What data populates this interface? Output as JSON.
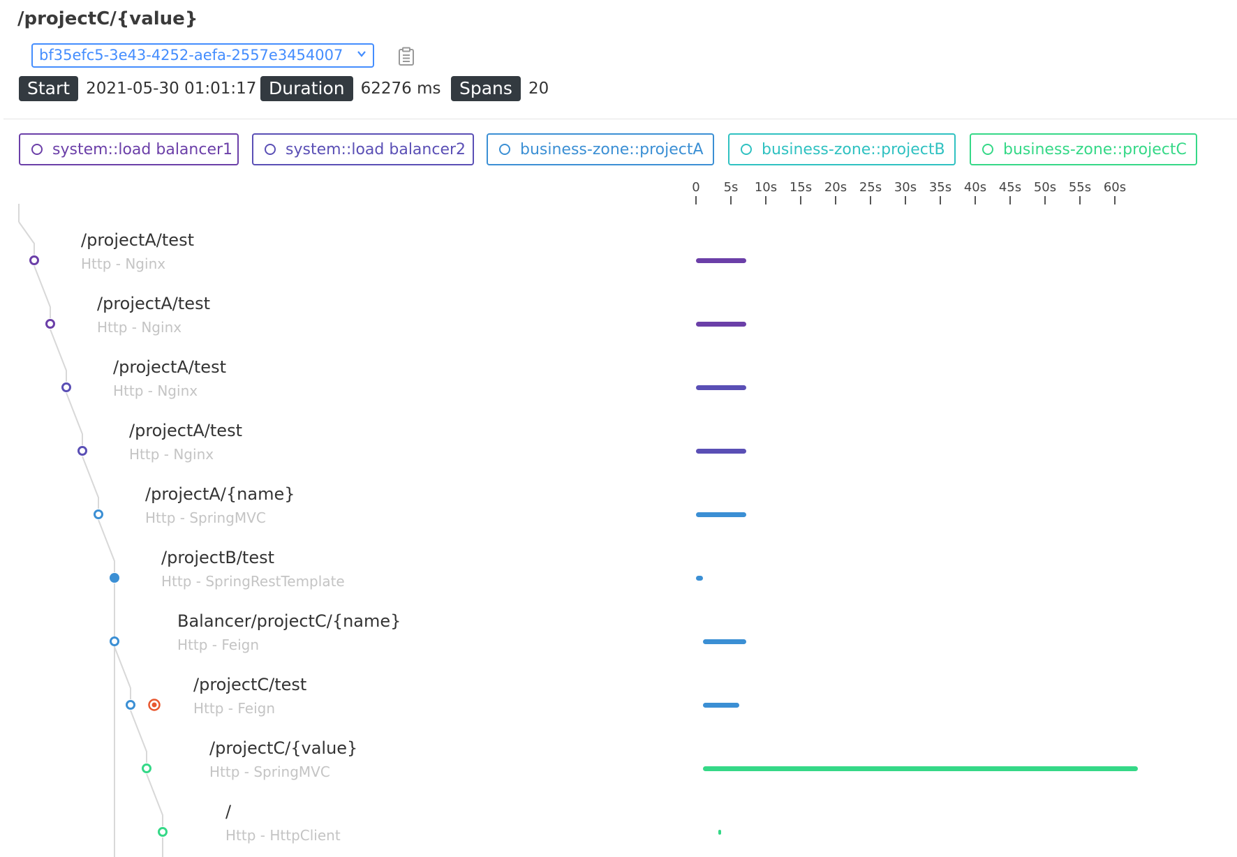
{
  "header": {
    "title": "/projectC/{value}",
    "trace_id": "bf35efc5-3e43-4252-aefa-2557e3454007",
    "copy_icon": "clipboard-icon"
  },
  "meta": {
    "start_label": "Start",
    "start_value": "2021-05-30 01:01:17",
    "duration_label": "Duration",
    "duration_value": "62276 ms",
    "spans_label": "Spans",
    "spans_value": "20"
  },
  "legend": [
    {
      "label": "system::load balancer1",
      "color": "#6b3fa8"
    },
    {
      "label": "system::load balancer2",
      "color": "#5a4fb5"
    },
    {
      "label": "business-zone::projectA",
      "color": "#3b8fd4"
    },
    {
      "label": "business-zone::projectB",
      "color": "#2fc1c1"
    },
    {
      "label": "business-zone::projectC",
      "color": "#35d887"
    }
  ],
  "axis": {
    "unit": "s",
    "ticks": [
      "0",
      "5s",
      "10s",
      "15s",
      "20s",
      "25s",
      "30s",
      "35s",
      "40s",
      "45s",
      "50s",
      "55s",
      "60s"
    ],
    "tick_values": [
      0,
      5,
      10,
      15,
      20,
      25,
      30,
      35,
      40,
      45,
      50,
      55,
      60
    ]
  },
  "spans": [
    {
      "name": "/projectA/test",
      "sub": "Http - Nginx",
      "color": "#6b3fa8",
      "start_s": 0.0,
      "end_s": 7.2,
      "depth": 0,
      "node": "ring"
    },
    {
      "name": "/projectA/test",
      "sub": "Http - Nginx",
      "color": "#6b3fa8",
      "start_s": 0.0,
      "end_s": 7.2,
      "depth": 1,
      "node": "ring"
    },
    {
      "name": "/projectA/test",
      "sub": "Http - Nginx",
      "color": "#5a4fb5",
      "start_s": 0.0,
      "end_s": 7.2,
      "depth": 2,
      "node": "ring"
    },
    {
      "name": "/projectA/test",
      "sub": "Http - Nginx",
      "color": "#5a4fb5",
      "start_s": 0.0,
      "end_s": 7.2,
      "depth": 3,
      "node": "ring"
    },
    {
      "name": "/projectA/{name}",
      "sub": "Http - SpringMVC",
      "color": "#3b8fd4",
      "start_s": 0.0,
      "end_s": 7.2,
      "depth": 4,
      "node": "ring"
    },
    {
      "name": "/projectB/test",
      "sub": "Http - SpringRestTemplate",
      "color": "#3b8fd4",
      "start_s": 0.0,
      "end_s": 1.0,
      "depth": 5,
      "node": "filled"
    },
    {
      "name": "Balancer/projectC/{name}",
      "sub": "Http - Feign",
      "color": "#3b8fd4",
      "start_s": 1.0,
      "end_s": 7.2,
      "depth": 5,
      "node": "ring"
    },
    {
      "name": "/projectC/test",
      "sub": "Http - Feign",
      "color": "#3b8fd4",
      "start_s": 1.0,
      "end_s": 6.2,
      "depth": 6,
      "node": "ring",
      "error": true
    },
    {
      "name": "/projectC/{value}",
      "sub": "Http - SpringMVC",
      "color": "#35d887",
      "start_s": 1.0,
      "end_s": 63.3,
      "depth": 7,
      "node": "ring"
    },
    {
      "name": "/",
      "sub": "Http - HttpClient",
      "color": "#35d887",
      "start_s": 3.2,
      "end_s": 3.4,
      "depth": 8,
      "node": "ring"
    }
  ],
  "error_color": "#e8572f"
}
